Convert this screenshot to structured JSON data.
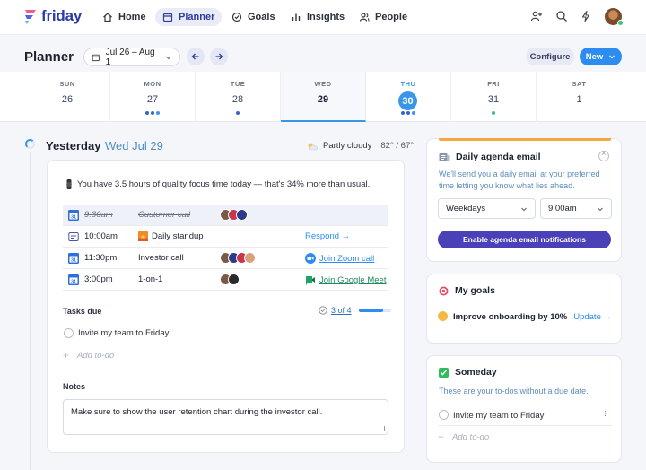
{
  "nav": {
    "logo": "friday",
    "items": [
      {
        "label": "Home",
        "icon": "home-icon"
      },
      {
        "label": "Planner",
        "icon": "calendar-icon",
        "active": true
      },
      {
        "label": "Goals",
        "icon": "goal-icon"
      },
      {
        "label": "Insights",
        "icon": "chart-icon"
      },
      {
        "label": "People",
        "icon": "people-icon"
      }
    ]
  },
  "planner": {
    "title": "Planner",
    "date_range": "Jul 26 – Aug 1",
    "configure_label": "Configure",
    "new_label": "New"
  },
  "days": [
    {
      "name": "SUN",
      "num": "26",
      "dots": []
    },
    {
      "name": "MON",
      "num": "27",
      "dots": [
        "#3a63c8",
        "#3a63c8",
        "#3a97e8"
      ]
    },
    {
      "name": "TUE",
      "num": "28",
      "dots": [
        "#3a63c8"
      ]
    },
    {
      "name": "WED",
      "num": "29",
      "dots": [],
      "selected": true
    },
    {
      "name": "THU",
      "num": "30",
      "dots": [
        "#3a63c8",
        "#3a63c8",
        "#3a97e8"
      ],
      "today": true
    },
    {
      "name": "FRI",
      "num": "31",
      "dots": [
        "#3ab8a0"
      ]
    },
    {
      "name": "SAT",
      "num": "1",
      "dots": []
    }
  ],
  "day_view": {
    "title": "Yesterday",
    "date": "Wed Jul 29",
    "weather": "Partly cloudy",
    "temp": "82° / 67°",
    "focus_text": "You have 3.5 hours of quality focus time today — that's 34% more than usual.",
    "events": [
      {
        "time": "9:30am",
        "title": "Customer call",
        "past": true,
        "action": ""
      },
      {
        "time": "10:00am",
        "title": "Daily standup",
        "action": "Respond →"
      },
      {
        "time": "11:30pm",
        "title": "Investor call",
        "action": "Join Zoom call"
      },
      {
        "time": "3:00pm",
        "title": "1-on-1",
        "action": "Join Google Meet"
      }
    ],
    "tasks": {
      "heading": "Tasks due",
      "count": "3 of 4",
      "progress": 0.75,
      "items": [
        "Invite my team to Friday"
      ],
      "add_placeholder": "Add to-do"
    },
    "notes": {
      "heading": "Notes",
      "text": "Make sure to show the user retention chart during the investor call."
    }
  },
  "agenda_panel": {
    "title": "Daily agenda email",
    "desc": "We'll send you a daily email at your preferred time letting you know what lies ahead.",
    "frequency": "Weekdays",
    "time": "9:00am",
    "button": "Enable agenda email notifications"
  },
  "goals_panel": {
    "title": "My goals",
    "goal": "Improve onboarding by 10%",
    "update": "Update →"
  },
  "someday_panel": {
    "title": "Someday",
    "desc": "These are your to-dos without a due date.",
    "items": [
      "Invite my team to Friday"
    ],
    "add_placeholder": "Add to-do"
  }
}
